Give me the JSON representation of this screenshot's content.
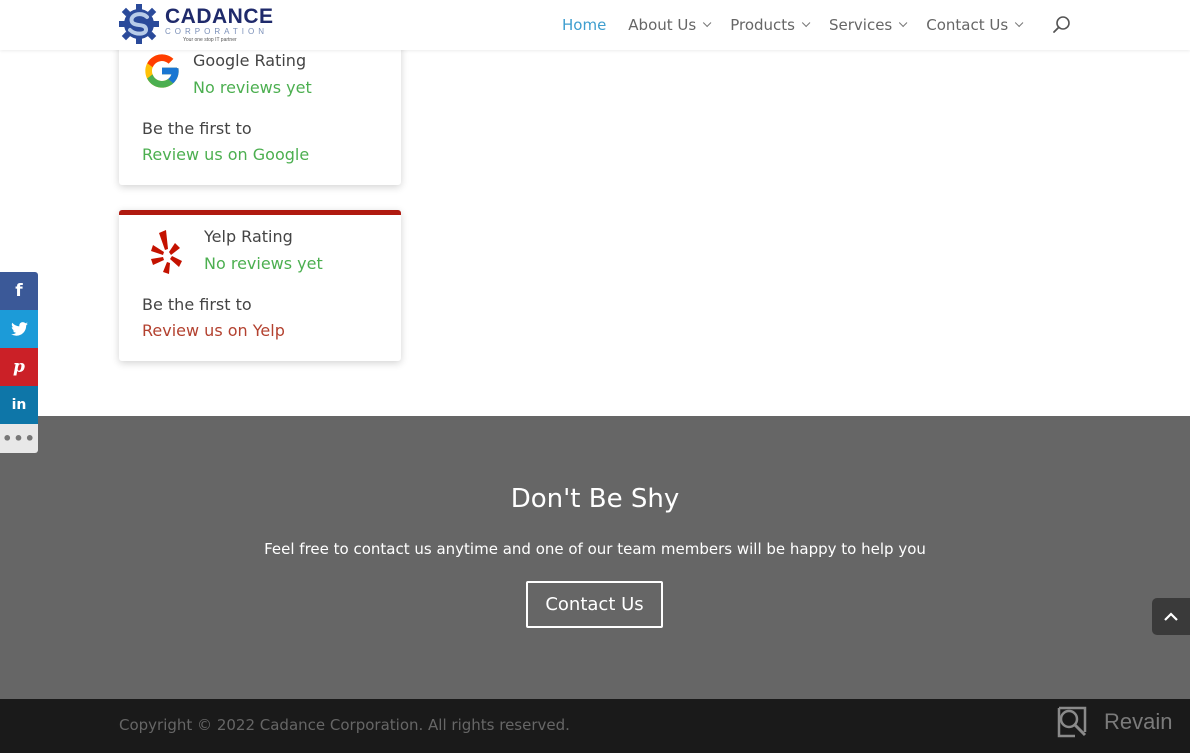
{
  "header": {
    "logo": {
      "name": "CADANCE",
      "sub": "CORPORATION",
      "tagline": "Your one stop IT partner"
    },
    "nav": [
      {
        "label": "Home",
        "active": true,
        "has_dropdown": false
      },
      {
        "label": "About Us",
        "active": false,
        "has_dropdown": true
      },
      {
        "label": "Products",
        "active": false,
        "has_dropdown": true
      },
      {
        "label": "Services",
        "active": false,
        "has_dropdown": true
      },
      {
        "label": "Contact Us",
        "active": false,
        "has_dropdown": true
      }
    ],
    "search_icon": "search-icon"
  },
  "reviews": {
    "google": {
      "title": "Google Rating",
      "status": "No reviews yet",
      "prompt": "Be the first to",
      "link": "Review us on Google",
      "link_color": "#4caf50"
    },
    "yelp": {
      "title": "Yelp Rating",
      "status": "No reviews yet",
      "prompt": "Be the first to",
      "link": "Review us on Yelp",
      "link_color": "#b3412f",
      "accent": "#b01a10"
    }
  },
  "social": {
    "buttons": [
      {
        "name": "facebook",
        "glyph": "f",
        "color": "#3b5998"
      },
      {
        "name": "twitter",
        "glyph": "twitter-bird",
        "color": "#1c9bd8"
      },
      {
        "name": "pinterest",
        "glyph": "P",
        "color": "#cb2027"
      },
      {
        "name": "linkedin",
        "glyph": "in",
        "color": "#0e76a8"
      },
      {
        "name": "more",
        "glyph": "•••",
        "color": "#e8e8e8"
      }
    ]
  },
  "cta": {
    "title": "Don't Be Shy",
    "text": "Feel free to contact us anytime and one of our team members will be happy to help you",
    "button": "Contact Us"
  },
  "footer": {
    "copyright": "Copyright © 2022 Cadance Corporation. All rights reserved.",
    "revain_label": "Revain"
  }
}
